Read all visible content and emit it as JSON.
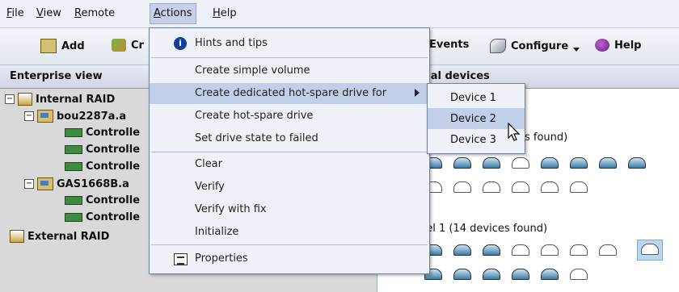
{
  "menubar": {
    "items": [
      {
        "label": "File",
        "mnemonic": "F",
        "rest": "ile"
      },
      {
        "label": "View",
        "mnemonic": "V",
        "rest": "iew"
      },
      {
        "label": "Remote",
        "mnemonic": "R",
        "rest": "emote"
      },
      {
        "label": "Actions",
        "mnemonic": "A",
        "rest": "ctions"
      },
      {
        "label": "Help",
        "mnemonic": "H",
        "rest": "elp"
      }
    ]
  },
  "toolbar": {
    "add_label": "Add",
    "create_label_visible": "Cr",
    "events_label_visible": "Events",
    "configure_label": "Configure",
    "help_label": "Help"
  },
  "left_panel": {
    "header": "Enterprise view",
    "tree": [
      {
        "label": "Internal RAID",
        "expanded": true
      },
      {
        "label": "bou2287a.a",
        "expanded": true
      },
      {
        "label": "Controlle"
      },
      {
        "label": "Controlle"
      },
      {
        "label": "Controlle"
      },
      {
        "label": "GAS1668B.a",
        "expanded": true
      },
      {
        "label": "Controlle"
      },
      {
        "label": "Controlle"
      },
      {
        "label": "External RAID"
      }
    ]
  },
  "right_panel": {
    "header_visible": "cal devices",
    "channel0_visible": "s found)",
    "channel1_visible": "nel 1  (14 devices found)"
  },
  "actions_menu": {
    "items": [
      {
        "label": "Hints and tips",
        "icon": "info-icon"
      },
      {
        "label": "Create simple volume"
      },
      {
        "label": "Create dedicated hot-spare drive for",
        "submenu": true,
        "highlighted": true
      },
      {
        "label": "Create hot-spare drive"
      },
      {
        "label": "Set drive state to failed"
      },
      {
        "label": "Clear"
      },
      {
        "label": "Verify"
      },
      {
        "label": "Verify with fix"
      },
      {
        "label": "Initialize"
      },
      {
        "label": "Properties",
        "icon": "properties-icon"
      }
    ]
  },
  "submenu": {
    "items": [
      {
        "label": "Device 1"
      },
      {
        "label": "Device 2",
        "highlighted": true
      },
      {
        "label": "Device 3"
      }
    ]
  },
  "colors": {
    "menu_highlight": "#c1cfe8",
    "menu_background": "#eef1f7",
    "panel_gray": "#d9d9d9",
    "info_blue": "#123f9b"
  }
}
